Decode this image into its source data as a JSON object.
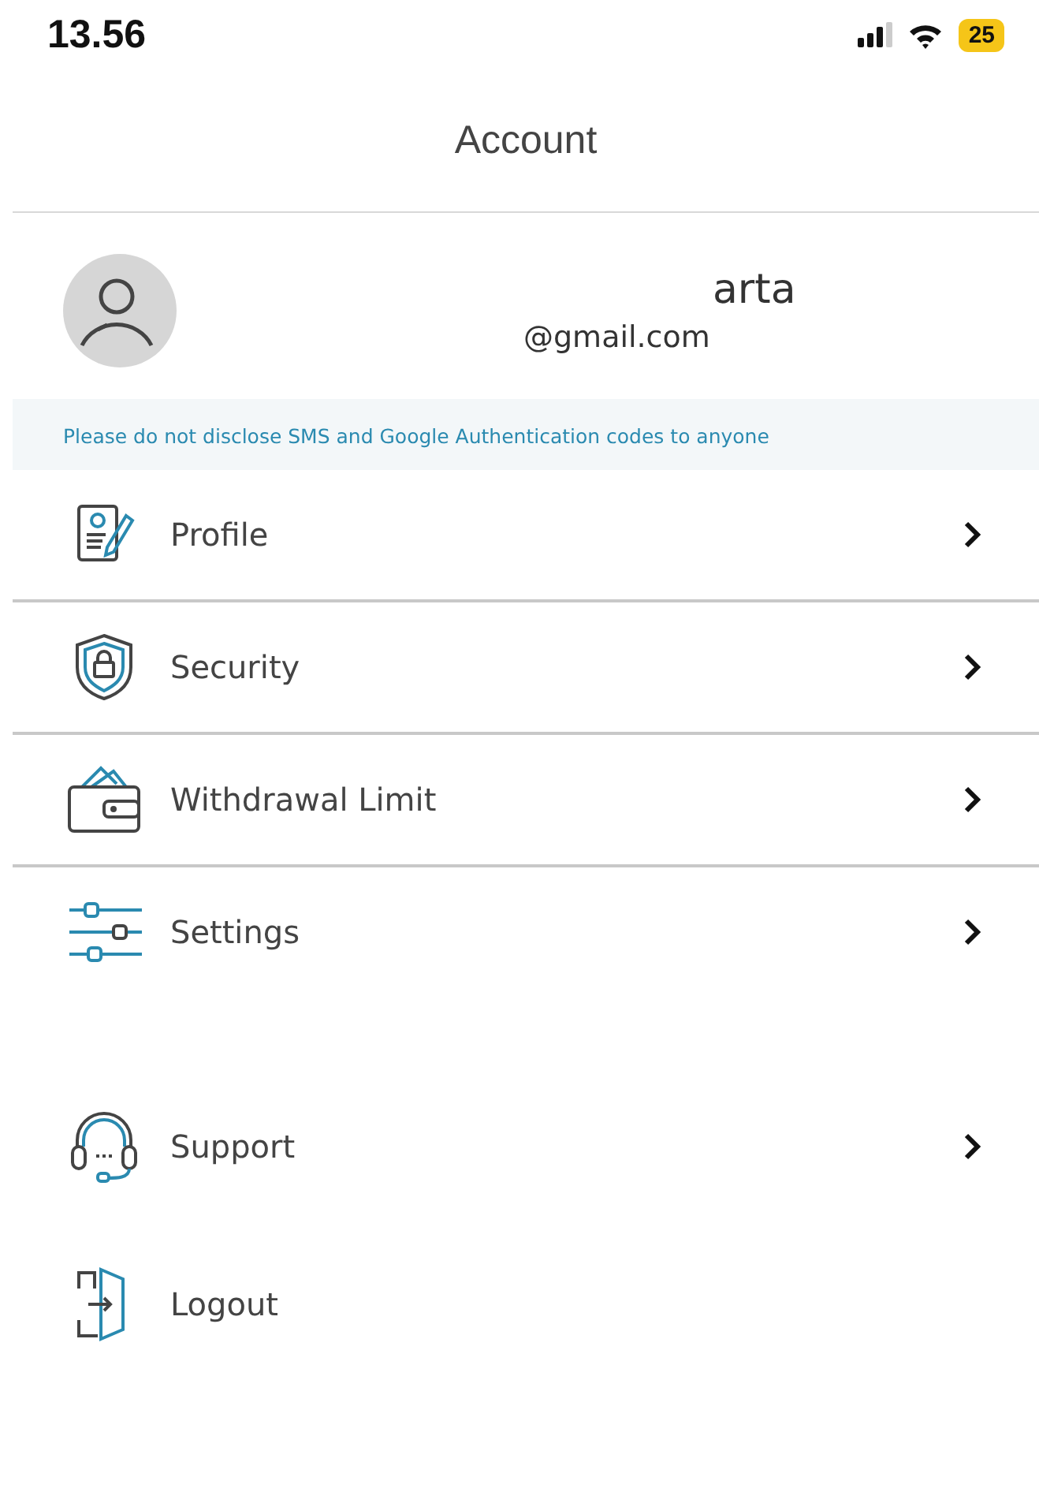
{
  "status_bar": {
    "time": "13.56",
    "battery": "25"
  },
  "header": {
    "title": "Account"
  },
  "profile": {
    "name": "arta",
    "email": "@gmail.com"
  },
  "notice": "Please do not disclose SMS and Google Authentication codes to anyone",
  "menu_groups": [
    {
      "items": [
        {
          "kind": "profile",
          "label": "Profile",
          "chevron": true
        },
        {
          "kind": "security",
          "label": "Security",
          "chevron": true
        },
        {
          "kind": "limit",
          "label": "Withdrawal Limit",
          "chevron": true
        },
        {
          "kind": "settings",
          "label": "Settings",
          "chevron": true
        }
      ]
    },
    {
      "items": [
        {
          "kind": "support",
          "label": "Support",
          "chevron": true
        },
        {
          "kind": "logout",
          "label": "Logout",
          "chevron": false
        }
      ]
    }
  ]
}
